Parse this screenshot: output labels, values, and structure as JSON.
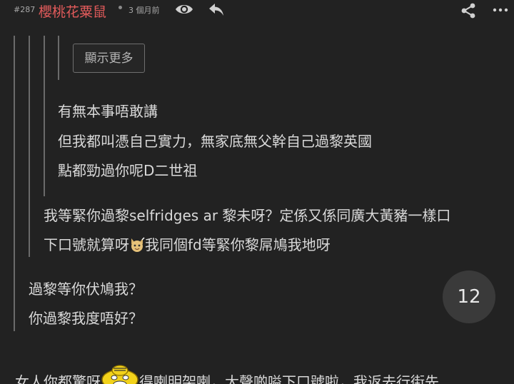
{
  "header": {
    "floor": "#287",
    "username": "櫻桃花粟鼠",
    "time": "3 個月前",
    "icons": [
      "eye-icon",
      "reply-icon",
      "share-icon",
      "more-icon"
    ]
  },
  "quote_level_4": {
    "show_more_label": "顯示更多"
  },
  "quote_level_3": {
    "lines": [
      "有無本事唔敢講",
      "但我都叫憑自己實力，無家底無父幹自己過黎英國",
      "點都勁過你呢D二世祖"
    ]
  },
  "quote_level_2": {
    "line1": "我等緊你過黎selfridges ar 黎未呀？定係又係同廣大黃豬一樣口",
    "line2_before": "下口號就算呀",
    "line2_after": "我同個fd等緊你黎屌鳩我地呀",
    "emoji": "cat-emoji"
  },
  "quote_level_1": {
    "lines": [
      "過黎等你伏鳩我？",
      "你過黎我度唔好？"
    ]
  },
  "reply_count": "12",
  "main_reply": {
    "before": "女人你都驚呀",
    "after": "得喇明架喇，大聲啲嗌下口號啦，我返去行街先",
    "emoji": "scared-face-emoji"
  },
  "colors": {
    "background": "#222222",
    "username": "#e35b5b",
    "text": "#d9d9d9",
    "quote_bar": "#6a6a6a"
  }
}
